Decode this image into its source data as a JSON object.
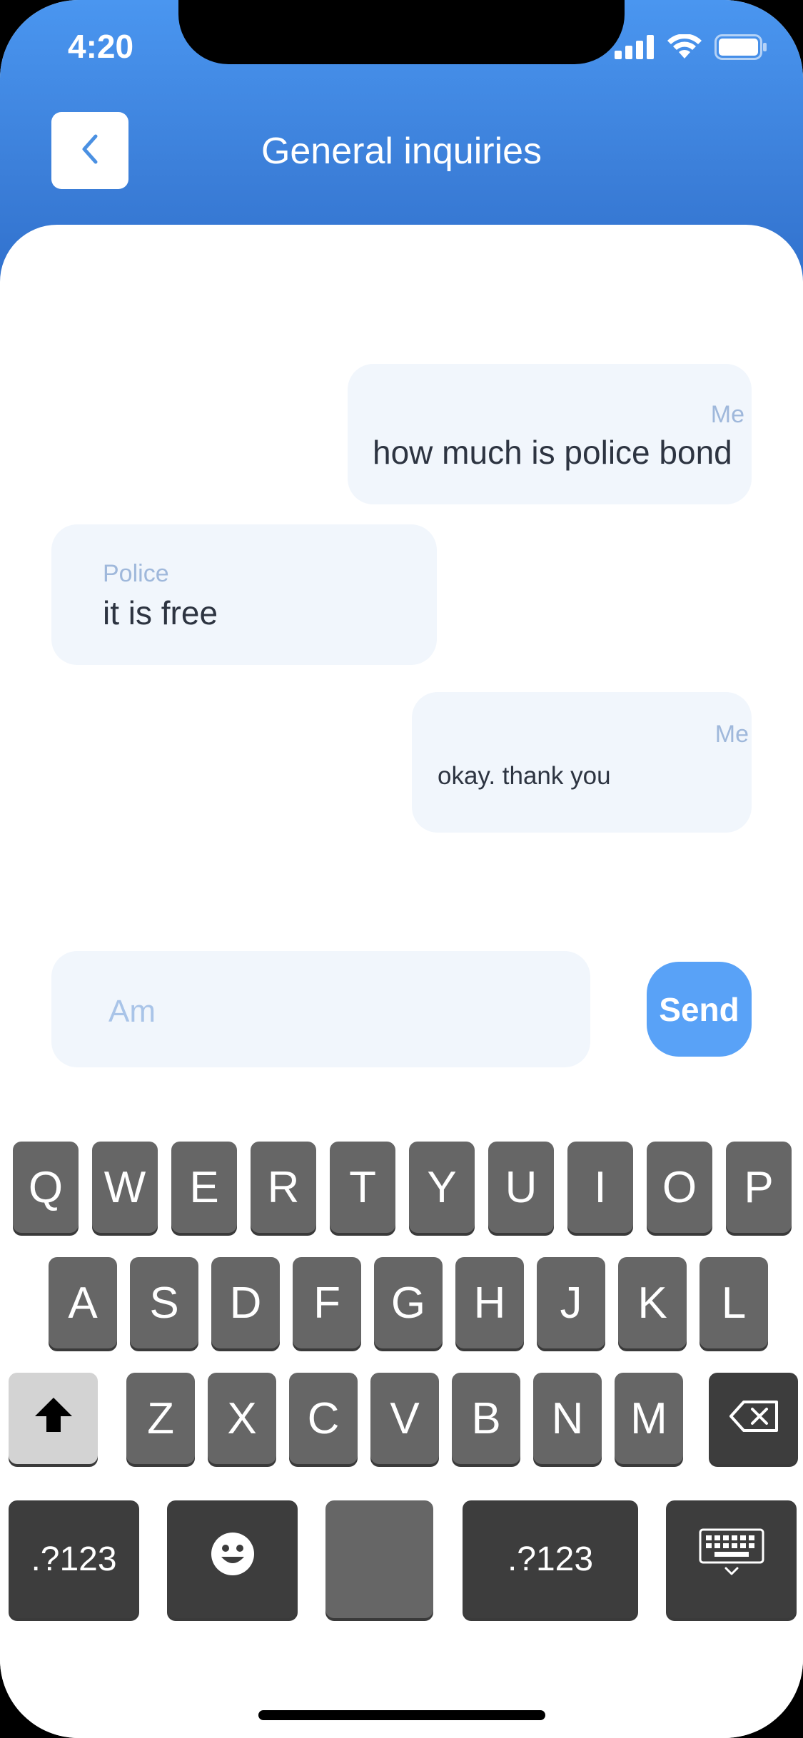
{
  "status": {
    "time": "4:20"
  },
  "header": {
    "title": "General inquiries"
  },
  "messages": [
    {
      "sender": "Me",
      "text": "how much is police bond"
    },
    {
      "sender": "Police",
      "text": "it is free"
    },
    {
      "sender": "Me",
      "text": "okay. thank you"
    }
  ],
  "composer": {
    "value": "Am",
    "send_label": "Send"
  },
  "keyboard": {
    "row1": [
      "Q",
      "W",
      "E",
      "R",
      "T",
      "Y",
      "U",
      "I",
      "O",
      "P"
    ],
    "row2": [
      "A",
      "S",
      "D",
      "F",
      "G",
      "H",
      "J",
      "K",
      "L"
    ],
    "row3": [
      "Z",
      "X",
      "C",
      "V",
      "B",
      "N",
      "M"
    ],
    "row4": {
      "symbols_left": ".?123",
      "symbols_right": ".?123"
    }
  },
  "colors": {
    "header_top": "#4a96f0",
    "header_bottom": "#2f6fcc",
    "bubble": "#f1f6fc",
    "send": "#59a2f7",
    "key": "#666666",
    "key_dark": "#3d3d3d"
  }
}
